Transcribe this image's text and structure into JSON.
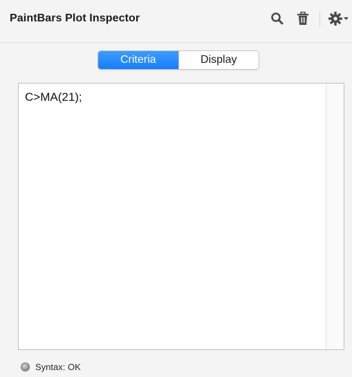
{
  "panel": {
    "title": "PaintBars Plot Inspector",
    "icons": {
      "search": "search-icon",
      "delete": "trash-icon",
      "settings": "gear-icon",
      "settings_menu": "chevron-down-icon"
    }
  },
  "tabs": [
    {
      "label": "Criteria",
      "selected": true
    },
    {
      "label": "Display",
      "selected": false
    }
  ],
  "editor": {
    "content": "C>MA(21);"
  },
  "status": {
    "label": "Syntax: OK",
    "indicator_color": "#9a9a9a"
  },
  "colors": {
    "accent": "#167dff",
    "background": "#f4f4f4"
  }
}
